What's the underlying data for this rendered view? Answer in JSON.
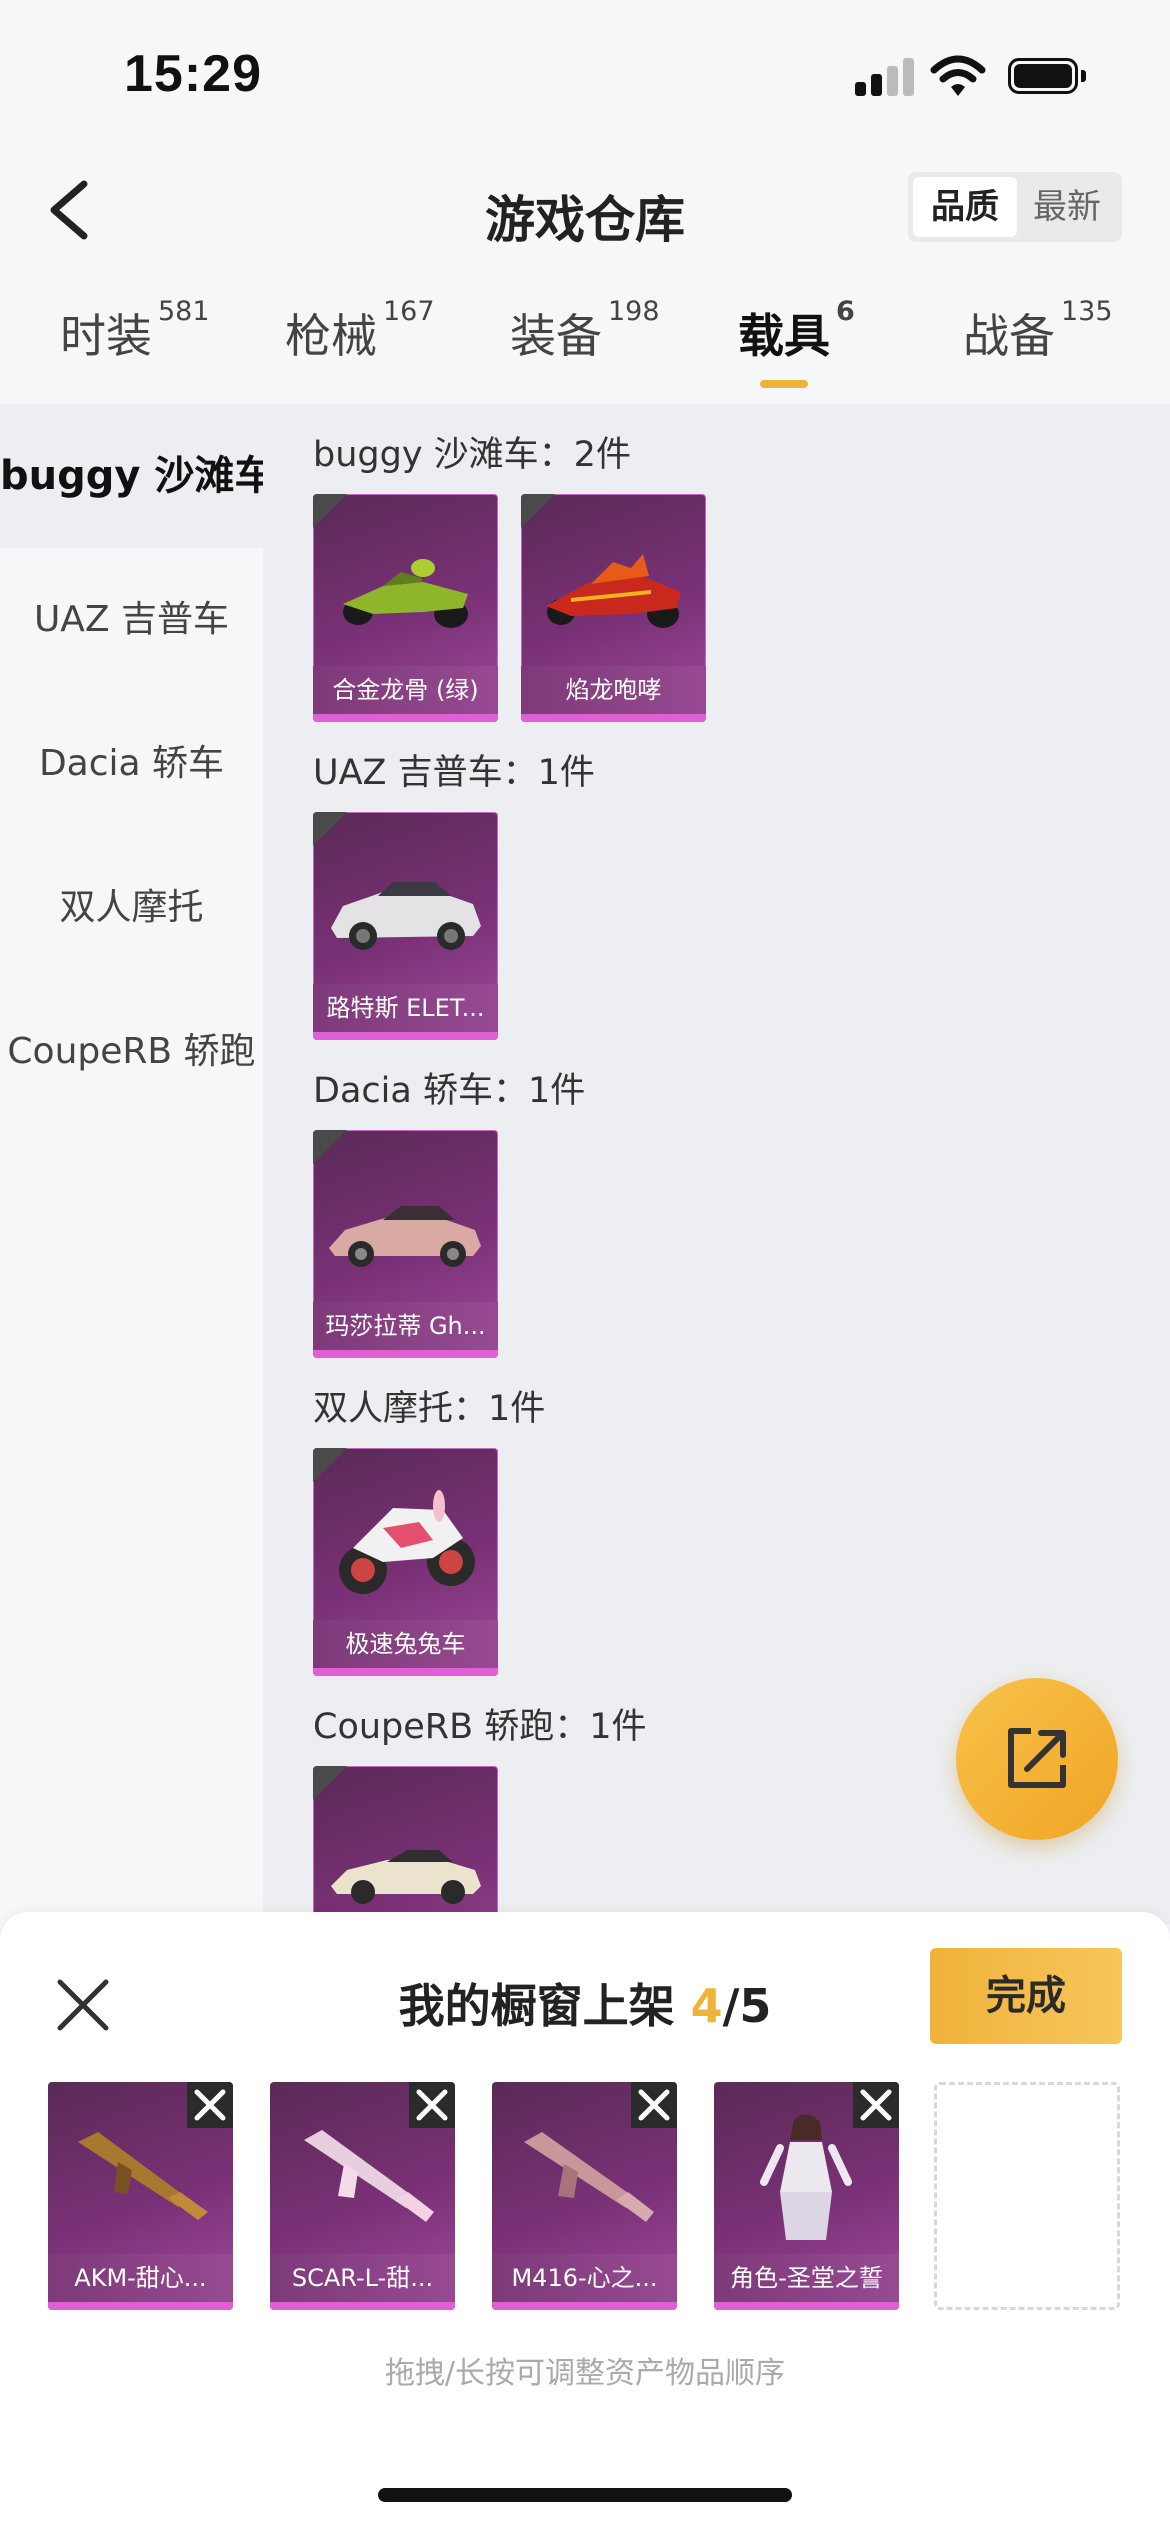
{
  "status": {
    "time": "15:29"
  },
  "header": {
    "title": "游戏仓库",
    "sort_options": [
      "品质",
      "最新"
    ]
  },
  "category_tabs": [
    {
      "label": "时装",
      "count": "581"
    },
    {
      "label": "枪械",
      "count": "167"
    },
    {
      "label": "装备",
      "count": "198"
    },
    {
      "label": "载具",
      "count": "6"
    },
    {
      "label": "战备",
      "count": "135"
    }
  ],
  "sidebar": [
    {
      "label": "buggy 沙滩车"
    },
    {
      "label": "UAZ 吉普车"
    },
    {
      "label": "Dacia 轿车"
    },
    {
      "label": "双人摩托"
    },
    {
      "label": "CoupeRB 轿跑"
    }
  ],
  "sections": [
    {
      "heading": "buggy 沙滩车：2件",
      "items": [
        "合金龙骨 (绿)",
        "焰龙咆哮"
      ]
    },
    {
      "heading": "UAZ 吉普车：1件",
      "items": [
        "路特斯 ELET..."
      ]
    },
    {
      "heading": "Dacia 轿车：1件",
      "items": [
        "玛莎拉蒂 Gh..."
      ]
    },
    {
      "heading": "双人摩托：1件",
      "items": [
        "极速兔兔车"
      ]
    },
    {
      "heading": "CoupeRB 轿跑：1件",
      "items": [
        ""
      ]
    }
  ],
  "showcase": {
    "title": "我的橱窗上架",
    "count": "4",
    "total": "/5",
    "done_label": "完成",
    "items": [
      "AKM-甜心...",
      "SCAR-L-甜...",
      "M416-心之...",
      "角色-圣堂之誓"
    ],
    "hint": "拖拽/长按可调整资产物品顺序"
  }
}
